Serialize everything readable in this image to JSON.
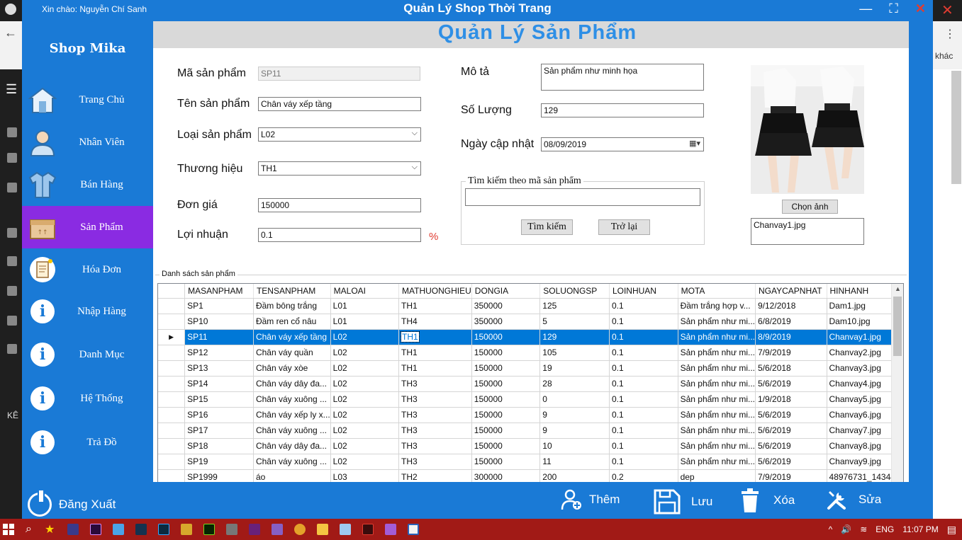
{
  "window": {
    "greeting": "Xin chào: Nguyễn Chí Sanh",
    "title": "Quản Lý Shop Thời Trang"
  },
  "browser_bg": {
    "right_text": "khác",
    "left_section": "KÊ"
  },
  "sidebar": {
    "logo": "Shop Mika",
    "items": [
      {
        "label": "Trang Chủ",
        "icon": "home-icon"
      },
      {
        "label": "Nhân Viên",
        "icon": "employee-icon"
      },
      {
        "label": "Bán Hàng",
        "icon": "shirt-icon"
      },
      {
        "label": "Sản Phẩm",
        "icon": "box-icon"
      },
      {
        "label": "Hóa Đơn",
        "icon": "invoice-icon"
      },
      {
        "label": "Nhập Hàng",
        "icon": "info-icon"
      },
      {
        "label": "Danh Mục",
        "icon": "info-icon"
      },
      {
        "label": "Hệ Thống",
        "icon": "info-icon"
      },
      {
        "label": "Trả Đồ",
        "icon": "info-icon"
      }
    ],
    "logout": "Đăng Xuất"
  },
  "page": {
    "title": "Quản Lý Sản Phẩm"
  },
  "form": {
    "ma_sp_label": "Mã sản phẩm",
    "ma_sp": "SP11",
    "ten_sp_label": "Tên sản phẩm",
    "ten_sp": "Chân váy xếp tầng",
    "loai_label": "Loại sản phẩm",
    "loai": "L02",
    "thuong_hieu_label": "Thương hiệu",
    "thuong_hieu": "TH1",
    "don_gia_label": "Đơn giá",
    "don_gia": "150000",
    "loi_nhuan_label": "Lợi nhuận",
    "loi_nhuan": "0.1",
    "pct": "%",
    "mo_ta_label": "Mô tả",
    "mo_ta": "Sản phẩm như minh họa",
    "so_luong_label": "Số Lượng",
    "so_luong": "129",
    "ngay_label": "Ngày cập nhật",
    "ngay": "08/09/2019"
  },
  "search": {
    "group_title": "Tìm kiếm theo mã sản phẩm",
    "value": "",
    "search_btn": "Tìm kiếm",
    "back_btn": "Trở lại"
  },
  "image": {
    "choose_btn": "Chọn ảnh",
    "filename": "Chanvay1.jpg"
  },
  "list": {
    "title": "Danh sách sản phẩm",
    "columns": [
      "MASANPHAM",
      "TENSANPHAM",
      "MALOAI",
      "MATHUONGHIEU",
      "DONGIA",
      "SOLUONGSP",
      "LOINHUAN",
      "MOTA",
      "NGAYCAPNHAT",
      "HINHANH"
    ],
    "rows": [
      [
        "SP1",
        "Đầm bông trắng",
        "L01",
        "TH1",
        "350000",
        "125",
        "0.1",
        "Đầm trắng hợp v...",
        "9/12/2018",
        "Dam1.jpg"
      ],
      [
        "SP10",
        "Đầm ren cổ nâu",
        "L01",
        "TH4",
        "350000",
        "5",
        "0.1",
        "Sản phẩm như mi...",
        "6/8/2019",
        "Dam10.jpg"
      ],
      [
        "SP11",
        "Chân váy xếp tầng",
        "L02",
        "TH1",
        "150000",
        "129",
        "0.1",
        "Sản phẩm như mi...",
        "8/9/2019",
        "Chanvay1.jpg"
      ],
      [
        "SP12",
        "Chân váy quần",
        "L02",
        "TH1",
        "150000",
        "105",
        "0.1",
        "Sản phẩm như mi...",
        "7/9/2019",
        "Chanvay2.jpg"
      ],
      [
        "SP13",
        "Chân váy xòe",
        "L02",
        "TH1",
        "150000",
        "19",
        "0.1",
        "Sản phẩm như mi...",
        "5/6/2018",
        "Chanvay3.jpg"
      ],
      [
        "SP14",
        "Chân váy dây đa...",
        "L02",
        "TH3",
        "150000",
        "28",
        "0.1",
        "Sản phẩm như mi...",
        "5/6/2019",
        "Chanvay4.jpg"
      ],
      [
        "SP15",
        "Chân váy xuông ...",
        "L02",
        "TH3",
        "150000",
        "0",
        "0.1",
        "Sản phẩm như mi...",
        "1/9/2018",
        "Chanvay5.jpg"
      ],
      [
        "SP16",
        "Chân váy xếp ly x...",
        "L02",
        "TH3",
        "150000",
        "9",
        "0.1",
        "Sản phẩm như mi...",
        "5/6/2019",
        "Chanvay6.jpg"
      ],
      [
        "SP17",
        "Chân váy xuông ...",
        "L02",
        "TH3",
        "150000",
        "9",
        "0.1",
        "Sản phẩm như mi...",
        "5/6/2019",
        "Chanvay7.jpg"
      ],
      [
        "SP18",
        "Chân váy dây đa...",
        "L02",
        "TH3",
        "150000",
        "10",
        "0.1",
        "Sản phẩm như mi...",
        "5/6/2019",
        "Chanvay8.jpg"
      ],
      [
        "SP19",
        "Chân váy xuông ...",
        "L02",
        "TH3",
        "150000",
        "11",
        "0.1",
        "Sản phẩm như mi...",
        "5/6/2019",
        "Chanvay9.jpg"
      ],
      [
        "SP1999",
        "áo",
        "L03",
        "TH2",
        "300000",
        "200",
        "0.2",
        "dep",
        "7/9/2019",
        "48976731_14344..."
      ]
    ],
    "selected_index": 2
  },
  "actions": {
    "add": "Thêm",
    "save": "Lưu",
    "delete": "Xóa",
    "edit": "Sửa"
  },
  "taskbar": {
    "lang": "ENG",
    "time": "11:07 PM"
  },
  "colors": {
    "app_blue": "#1a7ad6",
    "active_purple": "#8a2be2",
    "title_blue": "#2e8fe6",
    "selection": "#0078d7",
    "taskbar": "#a11a16"
  }
}
